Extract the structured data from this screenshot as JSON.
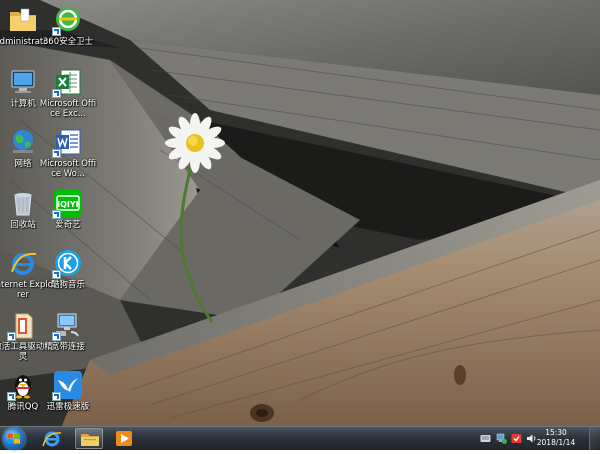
{
  "desktop": {
    "icons": [
      {
        "id": "administrator",
        "label": "Administrator",
        "icon": "folder-icon",
        "shortcut": false
      },
      {
        "id": "360-guard",
        "label": "360安全卫士",
        "icon": "360-shield-icon",
        "shortcut": true
      },
      {
        "id": "computer",
        "label": "计算机",
        "icon": "computer-icon",
        "shortcut": false
      },
      {
        "id": "excel",
        "label": "Microsoft Office Exc...",
        "icon": "excel-icon",
        "shortcut": true
      },
      {
        "id": "network",
        "label": "网络",
        "icon": "network-globe-icon",
        "shortcut": false
      },
      {
        "id": "word",
        "label": "Microsoft Office Wo...",
        "icon": "word-icon",
        "shortcut": true
      },
      {
        "id": "recycle-bin",
        "label": "回收站",
        "icon": "recycle-bin-icon",
        "shortcut": false
      },
      {
        "id": "iqiyi",
        "label": "爱奇艺",
        "icon": "iqiyi-icon",
        "shortcut": true
      },
      {
        "id": "ie",
        "label": "Internet Explorer",
        "icon": "internet-explorer-icon",
        "shortcut": false
      },
      {
        "id": "kugou",
        "label": "酷狗音乐",
        "icon": "kugou-icon",
        "shortcut": true
      },
      {
        "id": "driver-wizard",
        "label": "激活工具驱动精灵",
        "icon": "office-activator-icon",
        "shortcut": true
      },
      {
        "id": "broadband",
        "label": "宽带连接",
        "icon": "broadband-icon",
        "shortcut": true
      },
      {
        "id": "qq",
        "label": "腾讯QQ",
        "icon": "qq-penguin-icon",
        "shortcut": true
      },
      {
        "id": "thunder",
        "label": "迅雷极速版",
        "icon": "thunder-bird-icon",
        "shortcut": true
      }
    ]
  },
  "taskbar": {
    "start_icon": "windows-start-icon",
    "pinned": [
      {
        "id": "ie",
        "icon": "internet-explorer-icon"
      },
      {
        "id": "explorer",
        "icon": "file-explorer-icon"
      },
      {
        "id": "media-player",
        "icon": "media-player-icon"
      }
    ],
    "tray_icons": [
      "keyboard-icon",
      "network-status-icon",
      "security-icon",
      "volume-icon"
    ],
    "clock": {
      "time": "15:30",
      "date": "2018/1/14"
    }
  },
  "colors": {
    "taskbar": "#2b333b",
    "label_text": "#ffffff",
    "excel_green": "#1f7a3e",
    "word_blue": "#2b5fb4",
    "iqiyi_green": "#00be06",
    "kugou_blue": "#1aa1e8",
    "thunder_blue": "#2a8be6"
  }
}
